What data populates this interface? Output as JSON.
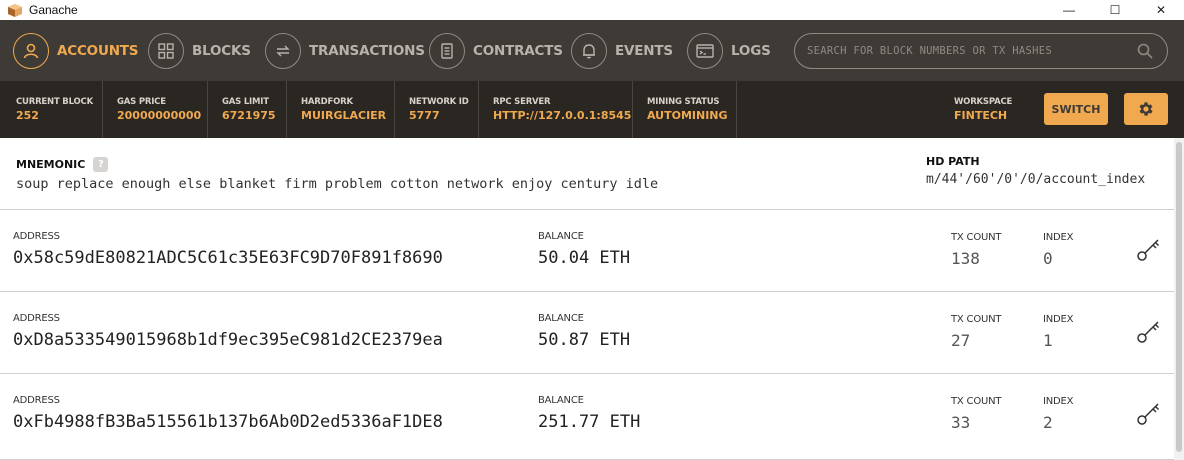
{
  "window": {
    "title": "Ganache",
    "controls": [
      "—",
      "☐",
      "✕"
    ]
  },
  "nav": {
    "items": [
      {
        "label": "ACCOUNTS",
        "icon": "user-icon",
        "active": true
      },
      {
        "label": "BLOCKS",
        "icon": "blocks-icon",
        "active": false
      },
      {
        "label": "TRANSACTIONS",
        "icon": "transactions-icon",
        "active": false
      },
      {
        "label": "CONTRACTS",
        "icon": "contracts-icon",
        "active": false
      },
      {
        "label": "EVENTS",
        "icon": "bell-icon",
        "active": false
      },
      {
        "label": "LOGS",
        "icon": "terminal-icon",
        "active": false
      }
    ],
    "search_placeholder": "SEARCH FOR BLOCK NUMBERS OR TX HASHES"
  },
  "stats": [
    {
      "label": "CURRENT BLOCK",
      "value": "252"
    },
    {
      "label": "GAS PRICE",
      "value": "20000000000"
    },
    {
      "label": "GAS LIMIT",
      "value": "6721975"
    },
    {
      "label": "HARDFORK",
      "value": "MUIRGLACIER"
    },
    {
      "label": "NETWORK ID",
      "value": "5777"
    },
    {
      "label": "RPC SERVER",
      "value": "HTTP://127.0.0.1:8545"
    },
    {
      "label": "MINING STATUS",
      "value": "AUTOMINING"
    }
  ],
  "workspace": {
    "label": "WORKSPACE",
    "value": "FINTECH",
    "switch_label": "SWITCH"
  },
  "mnemonic": {
    "label": "MNEMONIC",
    "help": "?",
    "value": "soup replace enough else blanket firm problem cotton network enjoy century idle",
    "hd_label": "HD PATH",
    "hd_value": "m/44'/60'/0'/0/account_index"
  },
  "account_labels": {
    "address": "ADDRESS",
    "balance": "BALANCE",
    "tx_count": "TX COUNT",
    "index": "INDEX"
  },
  "accounts": [
    {
      "address": "0x58c59dE80821ADC5C61c35E63FC9D70F891f8690",
      "balance": "50.04 ETH",
      "tx_count": "138",
      "index": "0"
    },
    {
      "address": "0xD8a533549015968b1df9ec395eC981d2CE2379ea",
      "balance": "50.87 ETH",
      "tx_count": "27",
      "index": "1"
    },
    {
      "address": "0xFb4988fB3Ba515561b137b6Ab0D2ed5336aF1DE8",
      "balance": "251.77 ETH",
      "tx_count": "33",
      "index": "2"
    }
  ],
  "colors": {
    "accent": "#f0a94f",
    "nav_bg": "#3e3a36",
    "stats_bg": "#2a2723"
  }
}
